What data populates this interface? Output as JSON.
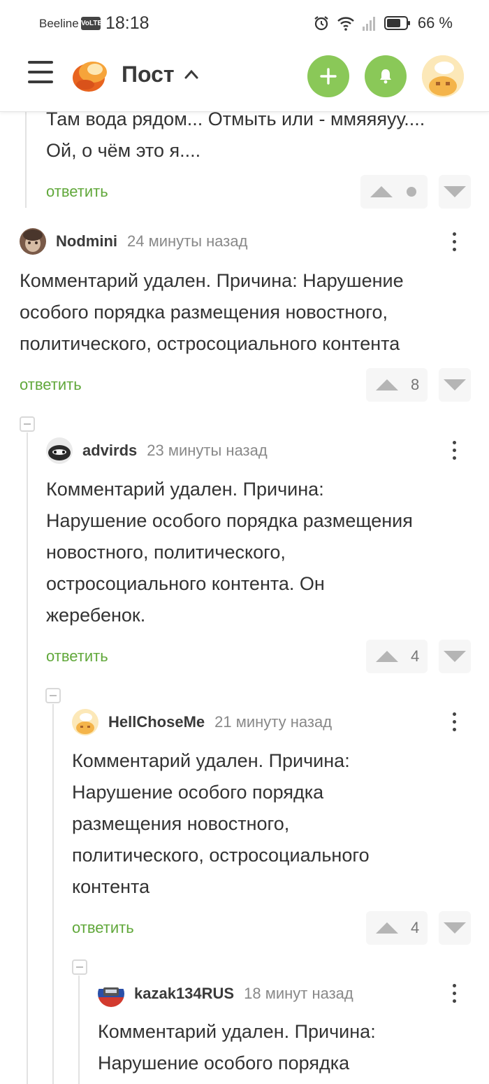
{
  "status_bar": {
    "carrier": "Beeline",
    "volte": "VoLTE",
    "time": "18:18",
    "battery_text": "66 %"
  },
  "header": {
    "title": "Пост",
    "icons": [
      "menu-icon",
      "app-logo",
      "caret-up-icon",
      "plus-icon",
      "bell-icon",
      "user-avatar"
    ]
  },
  "colors": {
    "accent_green": "#8ac858",
    "reply_green": "#61a83b",
    "text": "#333333",
    "muted": "#888888"
  },
  "comments": [
    {
      "text": "Там вода рядом... Отмыть или - ммяяяуу.... Ой, о чём это я....",
      "lines": [
        "Там вода рядом... Отмыть или - ммяяяуу....",
        "Ой, о чём это я...."
      ],
      "reply": "ответить",
      "score": ""
    },
    {
      "author": "Nodmini",
      "time": "24 минуты назад",
      "lines": [
        "Комментарий удален. Причина: Нарушение",
        "особого порядка размещения новостного,",
        "политического, остросоциального контента"
      ],
      "reply": "ответить",
      "score": "8"
    },
    {
      "author": "advirds",
      "time": "23 минуты назад",
      "lines": [
        "Комментарий удален. Причина:",
        "Нарушение особого порядка размещения",
        "новостного, политического,",
        "остросоциального контента. Он",
        "жеребенок."
      ],
      "reply": "ответить",
      "score": "4"
    },
    {
      "author": "HellChoseMe",
      "time": "21 минуту назад",
      "lines": [
        "Комментарий удален. Причина:",
        "Нарушение особого порядка",
        "размещения новостного,",
        "политического, остросоциального",
        "контента"
      ],
      "reply": "ответить",
      "score": "4"
    },
    {
      "author": "kazak134RUS",
      "time": "18 минут назад",
      "lines": [
        "Комментарий удален. Причина:",
        "Нарушение особого порядка"
      ]
    }
  ]
}
